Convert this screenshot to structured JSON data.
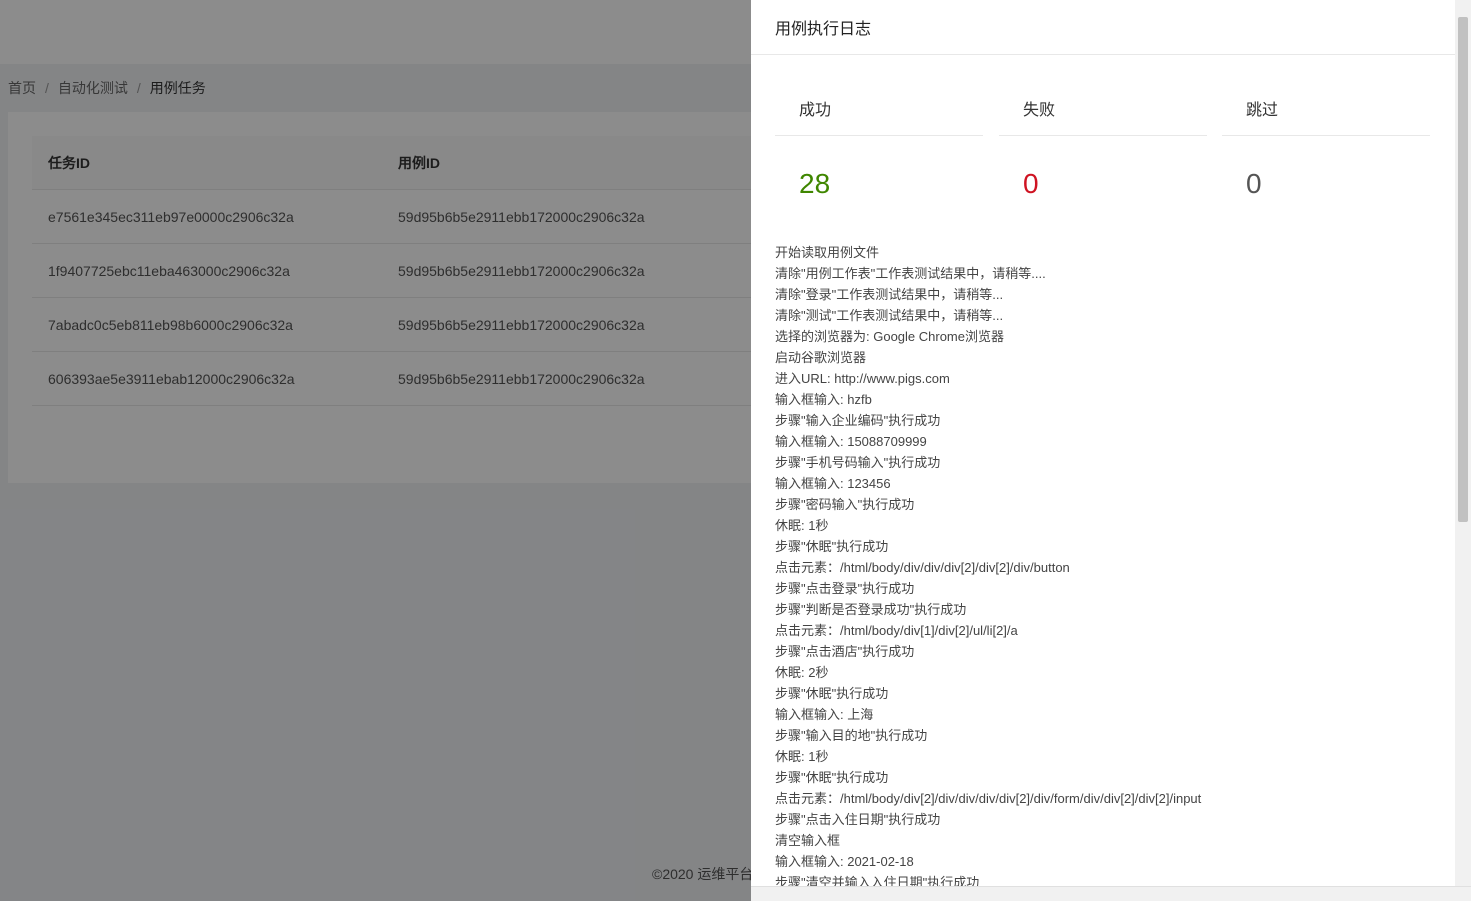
{
  "breadcrumb": {
    "home": "首页",
    "section": "自动化测试",
    "current": "用例任务",
    "separator": "/"
  },
  "table": {
    "headers": [
      "任务ID",
      "用例ID"
    ],
    "rows": [
      [
        "e7561e345ec311eb97e0000c2906c32a",
        "59d95b6b5e2911ebb172000c2906c32a"
      ],
      [
        "1f9407725ebc11eba463000c2906c32a",
        "59d95b6b5e2911ebb172000c2906c32a"
      ],
      [
        "7abadc0c5eb811eb98b6000c2906c32a",
        "59d95b6b5e2911ebb172000c2906c32a"
      ],
      [
        "606393ae5e3911ebab12000c2906c32a",
        "59d95b6b5e2911ebb172000c2906c32a"
      ]
    ]
  },
  "footer": {
    "text": "©2020 运维平台"
  },
  "drawer": {
    "title": "用例执行日志",
    "stats": [
      {
        "label": "成功",
        "value": "28",
        "color": "#3f8600"
      },
      {
        "label": "失败",
        "value": "0",
        "color": "#cf1322"
      },
      {
        "label": "跳过",
        "value": "0",
        "color": "#555555"
      }
    ],
    "log": [
      "开始读取用例文件",
      "清除\"用例工作表\"工作表测试结果中，请稍等....",
      "清除\"登录\"工作表测试结果中，请稍等...",
      "清除\"测试\"工作表测试结果中，请稍等...",
      "选择的浏览器为: Google Chrome浏览器",
      "启动谷歌浏览器",
      "进入URL: http://www.pigs.com",
      "输入框输入: hzfb",
      "步骤\"输入企业编码\"执行成功",
      "输入框输入: 15088709999",
      "步骤\"手机号码输入\"执行成功",
      "输入框输入: 123456",
      "步骤\"密码输入\"执行成功",
      "休眠: 1秒",
      "步骤\"休眠\"执行成功",
      "点击元素：/html/body/div/div/div[2]/div[2]/div/button",
      "步骤\"点击登录\"执行成功",
      "步骤\"判断是否登录成功\"执行成功",
      "点击元素：/html/body/div[1]/div[2]/ul/li[2]/a",
      "步骤\"点击酒店\"执行成功",
      "休眠: 2秒",
      "步骤\"休眠\"执行成功",
      "输入框输入: 上海",
      "步骤\"输入目的地\"执行成功",
      "休眠: 1秒",
      "步骤\"休眠\"执行成功",
      "点击元素：/html/body/div[2]/div/div/div/div[2]/div/form/div/div[2]/div[2]/input",
      "步骤\"点击入住日期\"执行成功",
      "清空输入框",
      "输入框输入: 2021-02-18",
      "步骤\"清空并输入入住日期\"执行成功"
    ]
  }
}
